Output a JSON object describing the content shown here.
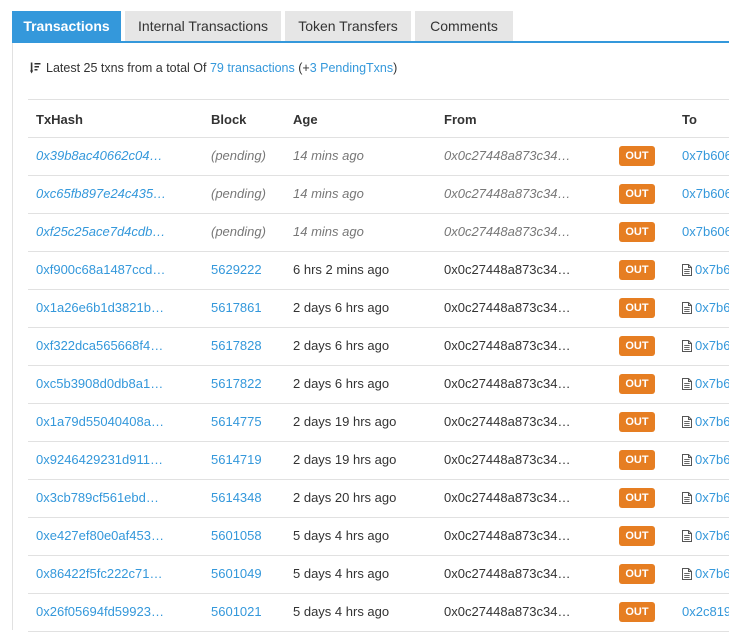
{
  "tabs": [
    "Transactions",
    "Internal Transactions",
    "Token Transfers",
    "Comments"
  ],
  "summary": {
    "prefix": "Latest 25 txns from a total Of",
    "total_link": "79 transactions",
    "pending_open": "(+",
    "pending_link": "3 PendingTxns",
    "pending_close": ")"
  },
  "columns": [
    "TxHash",
    "Block",
    "Age",
    "From",
    "To"
  ],
  "rows": [
    {
      "hash": "0x39b8ac40662c04…",
      "block": "(pending)",
      "age": "14 mins ago",
      "from": "0x0c27448a873c34…",
      "dir": "OUT",
      "to": "0x7b606",
      "pending": true,
      "contract": false
    },
    {
      "hash": "0xc65fb897e24c435…",
      "block": "(pending)",
      "age": "14 mins ago",
      "from": "0x0c27448a873c34…",
      "dir": "OUT",
      "to": "0x7b606",
      "pending": true,
      "contract": false
    },
    {
      "hash": "0xf25c25ace7d4cdb…",
      "block": "(pending)",
      "age": "14 mins ago",
      "from": "0x0c27448a873c34…",
      "dir": "OUT",
      "to": "0x7b606",
      "pending": true,
      "contract": false
    },
    {
      "hash": "0xf900c68a1487ccd…",
      "block": "5629222",
      "age": "6 hrs 2 mins ago",
      "from": "0x0c27448a873c34…",
      "dir": "OUT",
      "to": "0x7b6",
      "pending": false,
      "contract": true
    },
    {
      "hash": "0x1a26e6b1d3821b…",
      "block": "5617861",
      "age": "2 days 6 hrs ago",
      "from": "0x0c27448a873c34…",
      "dir": "OUT",
      "to": "0x7b6",
      "pending": false,
      "contract": true
    },
    {
      "hash": "0xf322dca565668f4…",
      "block": "5617828",
      "age": "2 days 6 hrs ago",
      "from": "0x0c27448a873c34…",
      "dir": "OUT",
      "to": "0x7b6",
      "pending": false,
      "contract": true
    },
    {
      "hash": "0xc5b3908d0db8a1…",
      "block": "5617822",
      "age": "2 days 6 hrs ago",
      "from": "0x0c27448a873c34…",
      "dir": "OUT",
      "to": "0x7b6",
      "pending": false,
      "contract": true
    },
    {
      "hash": "0x1a79d55040408a…",
      "block": "5614775",
      "age": "2 days 19 hrs ago",
      "from": "0x0c27448a873c34…",
      "dir": "OUT",
      "to": "0x7b6",
      "pending": false,
      "contract": true
    },
    {
      "hash": "0x9246429231d911…",
      "block": "5614719",
      "age": "2 days 19 hrs ago",
      "from": "0x0c27448a873c34…",
      "dir": "OUT",
      "to": "0x7b6",
      "pending": false,
      "contract": true
    },
    {
      "hash": "0x3cb789cf561ebd…",
      "block": "5614348",
      "age": "2 days 20 hrs ago",
      "from": "0x0c27448a873c34…",
      "dir": "OUT",
      "to": "0x7b6",
      "pending": false,
      "contract": true
    },
    {
      "hash": "0xe427ef80e0af453…",
      "block": "5601058",
      "age": "5 days 4 hrs ago",
      "from": "0x0c27448a873c34…",
      "dir": "OUT",
      "to": "0x7b6",
      "pending": false,
      "contract": true
    },
    {
      "hash": "0x86422f5fc222c71…",
      "block": "5601049",
      "age": "5 days 4 hrs ago",
      "from": "0x0c27448a873c34…",
      "dir": "OUT",
      "to": "0x7b6",
      "pending": false,
      "contract": true
    },
    {
      "hash": "0x26f05694fd59923…",
      "block": "5601021",
      "age": "5 days 4 hrs ago",
      "from": "0x0c27448a873c34…",
      "dir": "OUT",
      "to": "0x2c819",
      "pending": false,
      "contract": false
    }
  ],
  "colors": {
    "accent": "#3498db",
    "out_badge": "#e67e22",
    "tab_inactive": "#e6e6e6",
    "muted": "#777777"
  },
  "icons": {
    "sort": "sort-descending-icon",
    "contract": "document-icon"
  }
}
